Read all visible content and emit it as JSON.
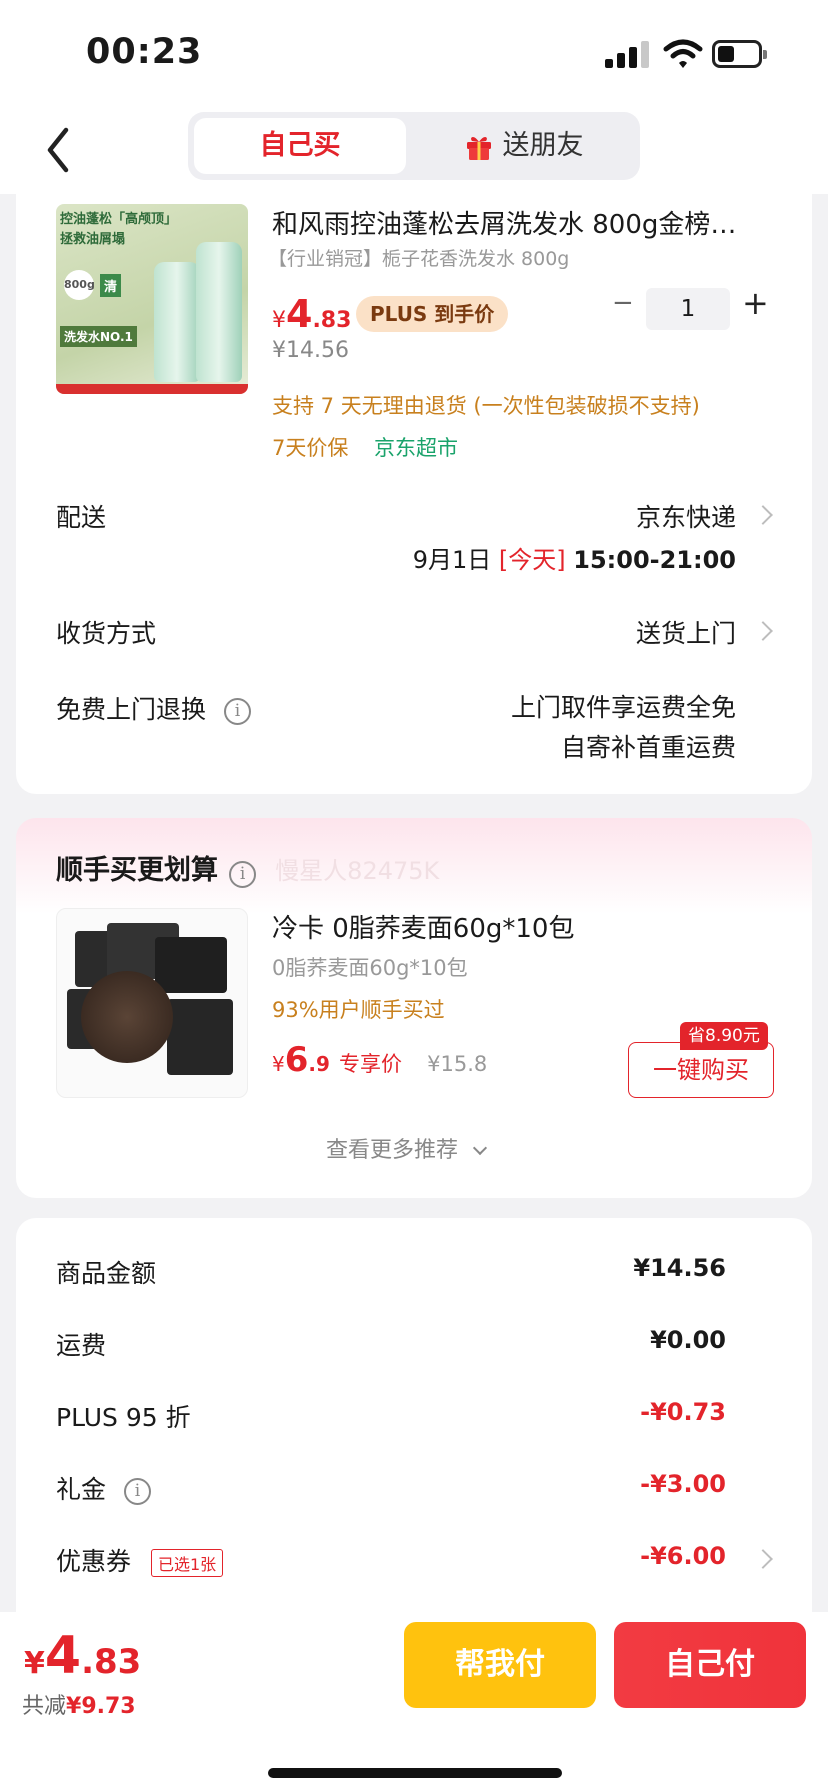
{
  "status_bar": {
    "time": "00:23"
  },
  "nav": {
    "tab_self": "自己买",
    "tab_gift": "送朋友"
  },
  "product": {
    "title": "和风雨控油蓬松去屑洗发水 800g金榜…",
    "subtitle": "【行业销冠】栀子花香洗发水 800g",
    "price_symbol": "¥",
    "price_int": "4",
    "price_dec": ".83",
    "plus_badge": "PLUS 到手价",
    "original_price": "¥14.56",
    "quantity": "1",
    "qty_minus": "−",
    "qty_plus": "+",
    "return_policy": "支持 7 天无理由退货 (一次性包装破损不支持)",
    "price_protect": "7天价保",
    "store_tag": "京东超市",
    "image_text": {
      "line1": "控油蓬松「高颅顶」",
      "line2": "拯救油屑塌",
      "badge": "800g",
      "badge2": "清",
      "label": "洗发水NO.1"
    }
  },
  "delivery": {
    "label": "配送",
    "carrier": "京东快递",
    "date": "9月1日",
    "today": "[今天]",
    "time_slot": "15:00-21:00"
  },
  "receive": {
    "label": "收货方式",
    "value": "送货上门"
  },
  "free_return": {
    "label": "免费上门退换",
    "line1": "上门取件享运费全免",
    "line2": "自寄补首重运费"
  },
  "recommend": {
    "title": "顺手买更划算",
    "watermark": "慢星人82475K",
    "item_title": "冷卡 0脂荞麦面60g*10包",
    "item_subtitle": "0脂荞麦面60g*10包",
    "item_note": "93%用户顺手买过",
    "price_symbol": "¥",
    "price_int": "6",
    "price_dec": ".9",
    "price_tag": "专享价",
    "original_price": "¥15.8",
    "save_badge": "省8.90元",
    "buy_button": "一键购买",
    "more": "查看更多推荐"
  },
  "summary": {
    "rows": [
      {
        "label": "商品金额",
        "value": "¥14.56"
      },
      {
        "label": "运费",
        "value": "¥0.00"
      },
      {
        "label": "PLUS 95 折",
        "value": "-¥0.73"
      },
      {
        "label": "礼金",
        "value": "-¥3.00"
      },
      {
        "label": "优惠券",
        "value": "-¥6.00",
        "tag": "已选1张"
      }
    ]
  },
  "bottom": {
    "price_symbol": "¥",
    "price_int": "4",
    "price_dec": ".83",
    "total_save_label": "共减",
    "total_save_value": "¥9.73",
    "help_pay": "帮我付",
    "self_pay": "自己付"
  },
  "colors": {
    "accent": "#e3242b",
    "orange_note": "#c8801e",
    "green_tag": "#1aa36b",
    "help_button": "#ffc20e"
  }
}
